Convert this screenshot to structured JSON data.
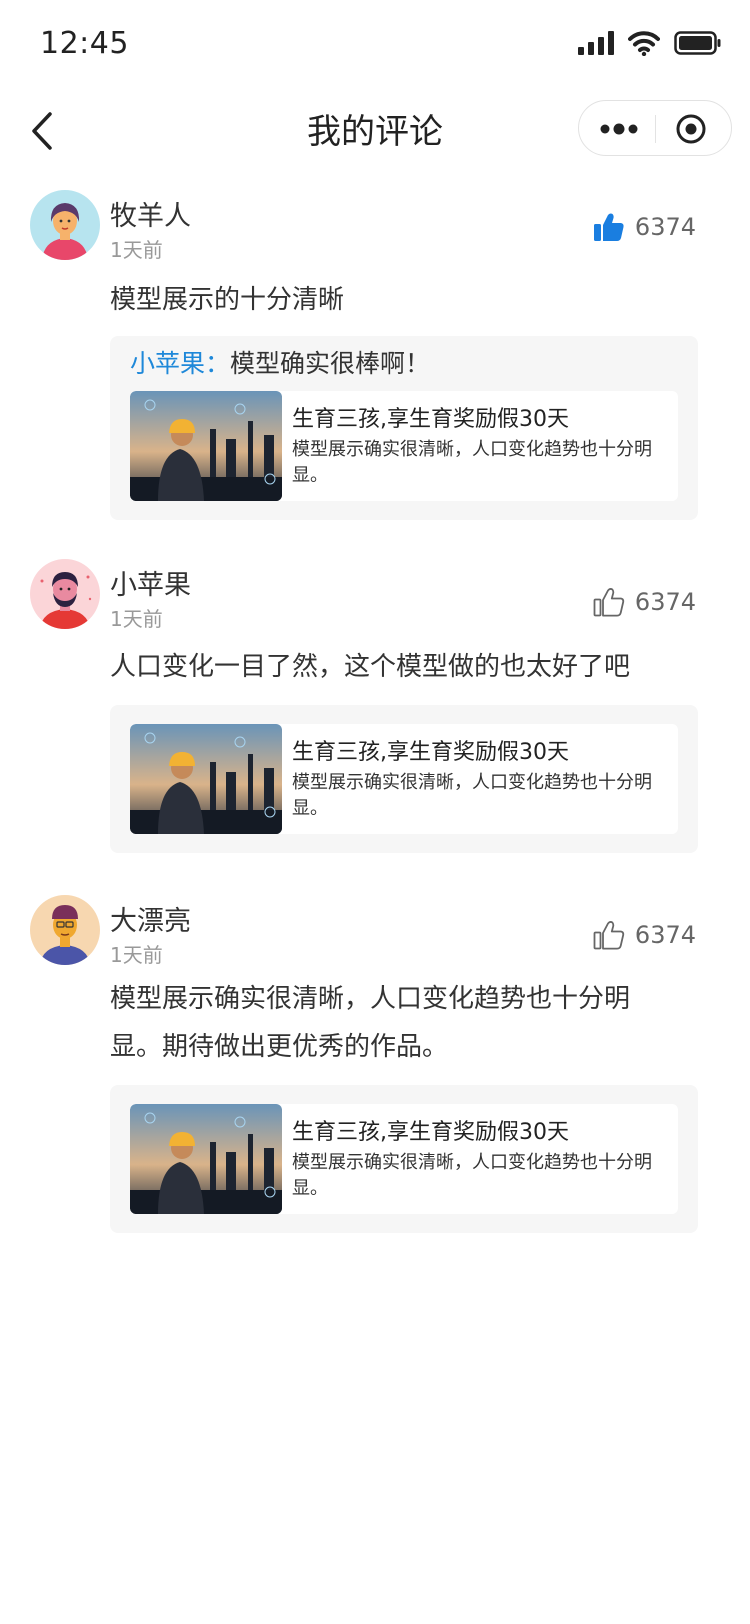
{
  "status_bar": {
    "time": "12:45"
  },
  "nav": {
    "title": "我的评论"
  },
  "comments": [
    {
      "user": "牧羊人",
      "time": "1天前",
      "likes": "6374",
      "liked": true,
      "text": "模型展示的十分清晰",
      "reply_user": "小苹果",
      "reply_sep": "：",
      "reply_text": "模型确实很棒啊！",
      "article_title": "生育三孩,享生育奖励假30天",
      "article_desc": "模型展示确实很清晰，人口变化趋势也十分明显。"
    },
    {
      "user": "小苹果",
      "time": "1天前",
      "likes": "6374",
      "liked": false,
      "text": "人口变化一目了然，这个模型做的也太好了吧",
      "article_title": "生育三孩,享生育奖励假30天",
      "article_desc": "模型展示确实很清晰，人口变化趋势也十分明显。"
    },
    {
      "user": "大漂亮",
      "time": "1天前",
      "likes": "6374",
      "liked": false,
      "text": "模型展示确实很清晰，人口变化趋势也十分明显。期待做出更优秀的作品。",
      "article_title": "生育三孩,享生育奖励假30天",
      "article_desc": "模型展示确实很清晰，人口变化趋势也十分明显。"
    }
  ],
  "colors": {
    "accent": "#1e88d9",
    "liked": "#1a7ee0",
    "text": "#333333",
    "muted": "#999999"
  }
}
